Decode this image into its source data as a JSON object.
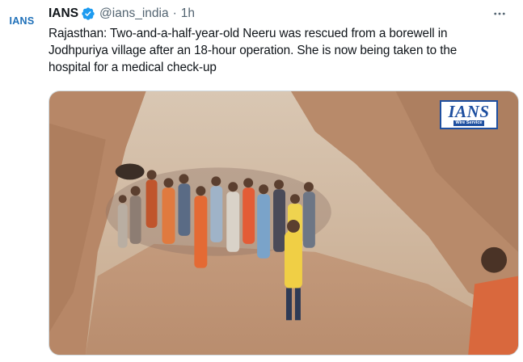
{
  "tweet": {
    "avatar_text": "IANS",
    "author_name": "IANS",
    "handle": "@ians_india",
    "separator": "·",
    "time": "1h",
    "text": "Rajasthan: Two-and-a-half-year-old Neeru was rescued from a borewell in\nJodhpuriya village after an 18-hour operation. She is now being taken to the\nhospital for a medical check-up"
  },
  "media": {
    "watermark_main": "IANS",
    "watermark_sub": "Wire Service"
  },
  "icons": {
    "verified": "verified-badge-icon",
    "more": "more-options-icon"
  },
  "colors": {
    "verified_badge": "#1d9bf0",
    "secondary_text": "#536471",
    "primary_text": "#0f1419",
    "logo_blue": "#1e4fa0"
  }
}
